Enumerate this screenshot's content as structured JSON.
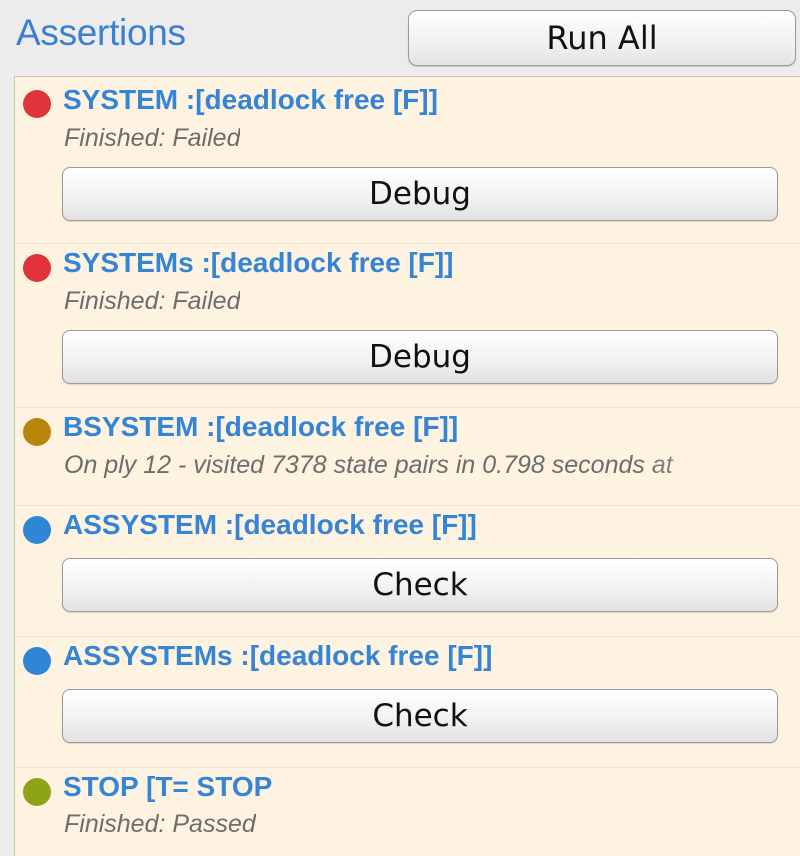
{
  "header": {
    "title": "Assertions",
    "run_all_label": "Run All"
  },
  "colors": {
    "failed": "#e0333a",
    "running": "#b8860b",
    "pending": "#2f86d6",
    "passed": "#8fa317",
    "accent_text": "#3584d6",
    "list_bg": "#fdf3e0"
  },
  "assertions": [
    {
      "name": "SYSTEM :[deadlock free [F]]",
      "status": "Finished: Failed",
      "state": "failed",
      "button": "Debug"
    },
    {
      "name": "SYSTEMs :[deadlock free [F]]",
      "status": "Finished: Failed",
      "state": "failed",
      "button": "Debug"
    },
    {
      "name": "BSYSTEM :[deadlock free [F]]",
      "status": "On ply 12 - visited 7378 state pairs in 0.798 seconds at",
      "state": "running"
    },
    {
      "name": "ASSYSTEM :[deadlock free [F]]",
      "state": "pending",
      "button": "Check"
    },
    {
      "name": "ASSYSTEMs :[deadlock free [F]]",
      "state": "pending",
      "button": "Check"
    },
    {
      "name": "STOP [T= STOP",
      "status": "Finished: Passed",
      "state": "passed"
    }
  ]
}
